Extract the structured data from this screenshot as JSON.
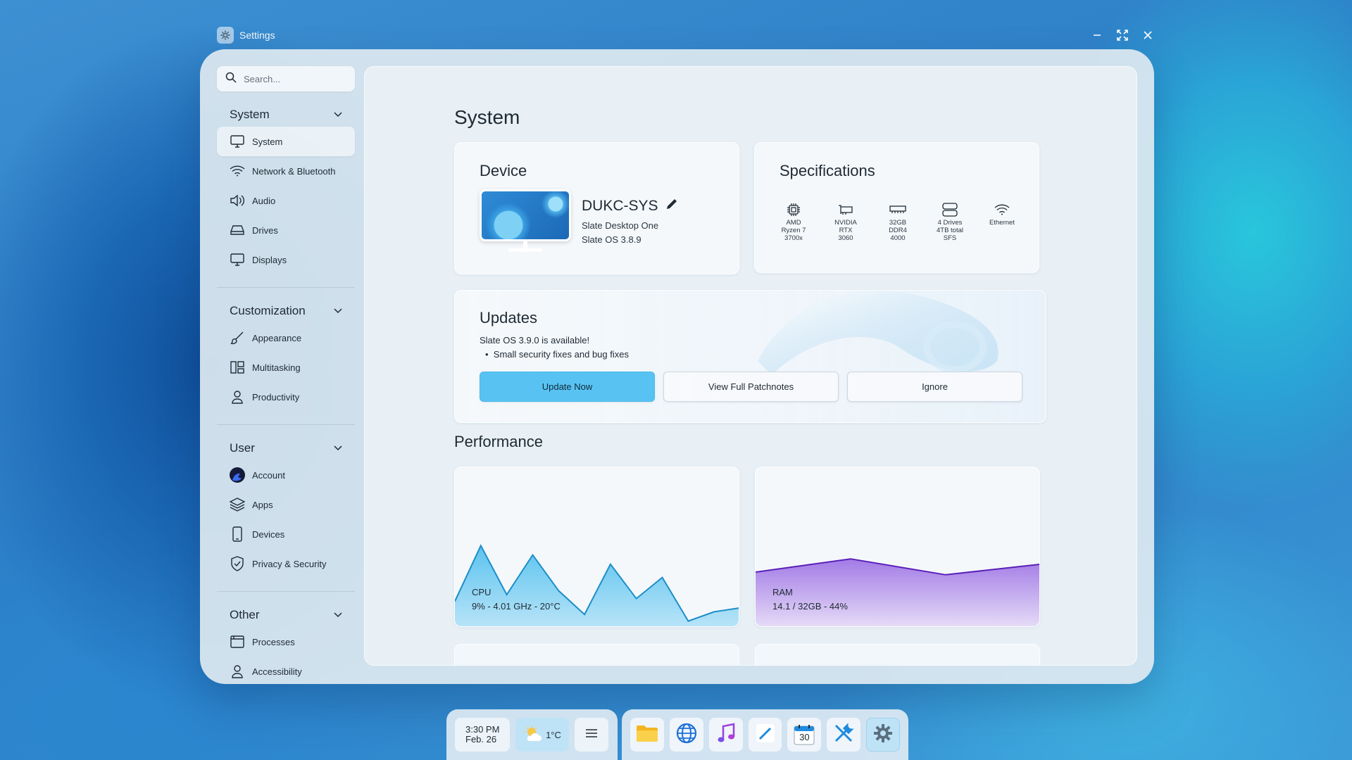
{
  "window": {
    "title": "Settings"
  },
  "search": {
    "placeholder": "Search..."
  },
  "sidebar": {
    "sections": [
      {
        "title": "System",
        "items": [
          {
            "label": "System",
            "icon": "monitor-icon",
            "active": true
          },
          {
            "label": "Network & Bluetooth",
            "icon": "wifi-icon"
          },
          {
            "label": "Audio",
            "icon": "speaker-icon"
          },
          {
            "label": "Drives",
            "icon": "drive-icon"
          },
          {
            "label": "Displays",
            "icon": "display-icon"
          }
        ]
      },
      {
        "title": "Customization",
        "items": [
          {
            "label": "Appearance",
            "icon": "brush-icon"
          },
          {
            "label": "Multitasking",
            "icon": "multitasking-icon"
          },
          {
            "label": "Productivity",
            "icon": "person-icon"
          }
        ]
      },
      {
        "title": "User",
        "items": [
          {
            "label": "Account",
            "icon": "avatar-icon"
          },
          {
            "label": "Apps",
            "icon": "layers-icon"
          },
          {
            "label": "Devices",
            "icon": "phone-icon"
          },
          {
            "label": "Privacy & Security",
            "icon": "shield-icon"
          }
        ]
      },
      {
        "title": "Other",
        "items": [
          {
            "label": "Processes",
            "icon": "processes-icon"
          },
          {
            "label": "Accessibility",
            "icon": "accessibility-icon"
          }
        ]
      }
    ]
  },
  "main": {
    "title": "System",
    "device": {
      "heading": "Device",
      "name": "DUKC-SYS",
      "model": "Slate Desktop One",
      "os": "Slate OS 3.8.9"
    },
    "specs": {
      "heading": "Specifications",
      "items": [
        {
          "icon": "cpu-icon",
          "label": "AMD\nRyzen 7\n3700x"
        },
        {
          "icon": "gpu-icon",
          "label": "NVIDIA\nRTX\n3060"
        },
        {
          "icon": "ram-icon",
          "label": "32GB\nDDR4\n4000"
        },
        {
          "icon": "storage-icon",
          "label": "4 Drives\n4TB total\nSFS"
        },
        {
          "icon": "wifi-icon",
          "label": "Ethernet"
        }
      ]
    },
    "updates": {
      "heading": "Updates",
      "message": "Slate OS 3.9.0 is available!",
      "bullet": "Small security fixes and bug fixes",
      "update_now": "Update Now",
      "view_patchnotes": "View Full Patchnotes",
      "ignore": "Ignore"
    },
    "performance": {
      "heading": "Performance",
      "cpu": {
        "label": "CPU",
        "stats": "9% - 4.01 GHz - 20°C",
        "color": "#2aa9e0"
      },
      "ram": {
        "label": "RAM",
        "stats": "14.1 / 32GB - 44%",
        "color": "#6a2fc4"
      }
    }
  },
  "taskbar": {
    "time": "3:30 PM",
    "date": "Feb. 26",
    "weather": "1°C",
    "apps": [
      "folder-icon",
      "browser-icon",
      "music-icon",
      "notes-icon",
      "calendar-icon",
      "tools-icon",
      "settings-icon"
    ],
    "calendar_day": "30"
  },
  "chart_data": [
    {
      "type": "area",
      "title": "CPU",
      "x": [
        0,
        1,
        2,
        3,
        4,
        5,
        6,
        7,
        8,
        9,
        10,
        11
      ],
      "values": [
        20,
        62,
        25,
        55,
        28,
        10,
        48,
        22,
        38,
        5,
        12,
        15
      ],
      "ylim": [
        0,
        100
      ]
    },
    {
      "type": "area",
      "title": "RAM",
      "x": [
        0,
        1,
        2,
        3
      ],
      "values": [
        42,
        52,
        40,
        48
      ],
      "ylim": [
        0,
        100
      ]
    }
  ]
}
